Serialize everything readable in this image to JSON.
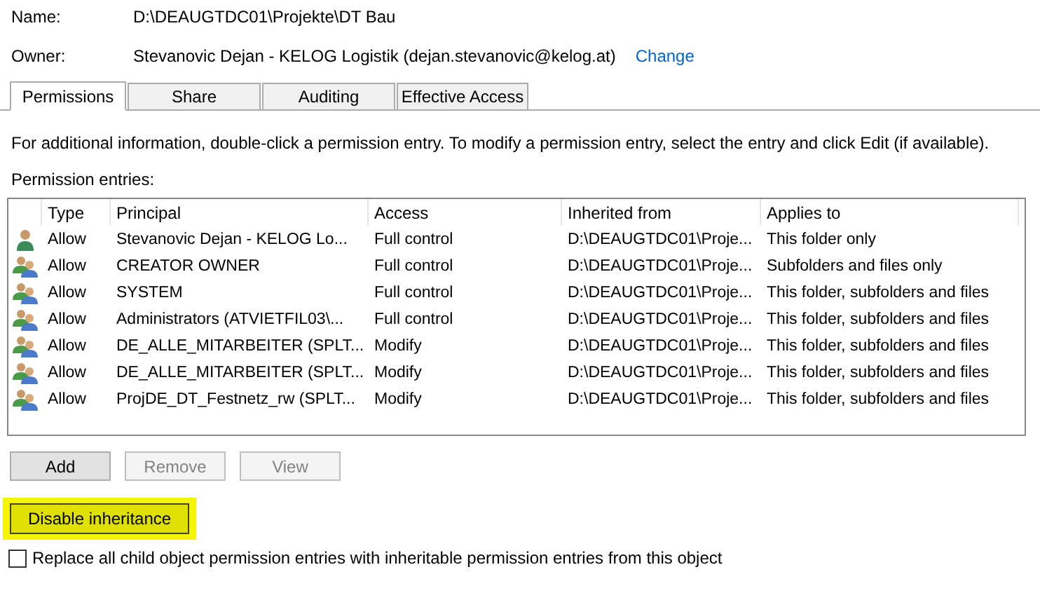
{
  "name": {
    "label": "Name:",
    "value": "D:\\DEAUGTDC01\\Projekte\\DT Bau"
  },
  "owner": {
    "label": "Owner:",
    "value": "Stevanovic Dejan - KELOG Logistik (dejan.stevanovic@kelog.at)",
    "link": "Change"
  },
  "tabs": [
    {
      "label": "Permissions",
      "selected": true
    },
    {
      "label": "Share",
      "selected": false
    },
    {
      "label": "Auditing",
      "selected": false
    },
    {
      "label": "Effective Access",
      "selected": false
    }
  ],
  "info": "For additional information, double-click a permission entry. To modify a permission entry, select the entry and click Edit (if available).",
  "entries_label": "Permission entries:",
  "table": {
    "columns": [
      "Type",
      "Principal",
      "Access",
      "Inherited from",
      "Applies to"
    ],
    "rows": [
      {
        "kind": "user",
        "cells": [
          "Allow",
          "Stevanovic Dejan - KELOG Lo...",
          "Full control",
          "D:\\DEAUGTDC01\\Proje...",
          "This folder only"
        ]
      },
      {
        "kind": "group",
        "cells": [
          "Allow",
          "CREATOR OWNER",
          "Full control",
          "D:\\DEAUGTDC01\\Proje...",
          "Subfolders and files only"
        ]
      },
      {
        "kind": "group",
        "cells": [
          "Allow",
          "SYSTEM",
          "Full control",
          "D:\\DEAUGTDC01\\Proje...",
          "This folder, subfolders and files"
        ]
      },
      {
        "kind": "group",
        "cells": [
          "Allow",
          "Administrators (ATVIETFIL03\\...",
          "Full control",
          "D:\\DEAUGTDC01\\Proje...",
          "This folder, subfolders and files"
        ]
      },
      {
        "kind": "group",
        "cells": [
          "Allow",
          "DE_ALLE_MITARBEITER (SPLT...",
          "Modify",
          "D:\\DEAUGTDC01\\Proje...",
          "This folder, subfolders and files"
        ]
      },
      {
        "kind": "group",
        "cells": [
          "Allow",
          "DE_ALLE_MITARBEITER (SPLT...",
          "Modify",
          "D:\\DEAUGTDC01\\Proje...",
          "This folder, subfolders and files"
        ]
      },
      {
        "kind": "group",
        "cells": [
          "Allow",
          "ProjDE_DT_Festnetz_rw (SPLT...",
          "Modify",
          "D:\\DEAUGTDC01\\Proje...",
          "This folder, subfolders and files"
        ]
      }
    ]
  },
  "buttons": [
    {
      "label": "Add",
      "disabled": false
    },
    {
      "label": "Remove",
      "disabled": true
    },
    {
      "label": "View",
      "disabled": true
    }
  ],
  "inheritance_button": {
    "label": "Disable inheritance",
    "highlighted": true
  },
  "replace_checkbox": {
    "label": "Replace all child object permission entries with inheritable permission entries from this object",
    "checked": false
  }
}
